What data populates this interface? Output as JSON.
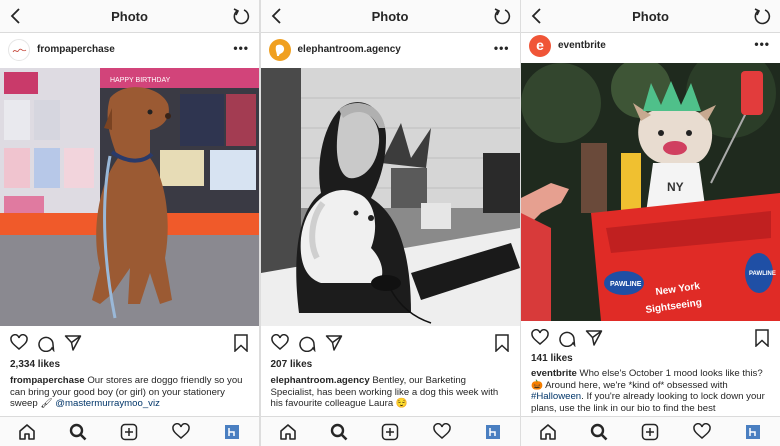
{
  "posts": [
    {
      "header_title": "Photo",
      "username": "frompaperchase",
      "avatar_text": "Paperchase",
      "more_label": "•••",
      "likes": "2,334 likes",
      "caption_user": "frompaperchase",
      "caption_text": "Our stores are doggo friendly so you can bring your good boy (or girl) on your stationery sweep 🖌",
      "caption_mention": "@mastermurraymoo_viz",
      "photo_sign": "HAPPY BIRTHDAY"
    },
    {
      "header_title": "Photo",
      "username": "elephantroom.agency",
      "more_label": "•••",
      "likes": "207 likes",
      "caption_user": "elephantroom.agency",
      "caption_text": "Bentley, our Barketing Specialist, has been working like a dog this week with his favourite colleague Laura 😌"
    },
    {
      "header_title": "Photo",
      "username": "eventbrite",
      "avatar_letter": "e",
      "more_label": "•••",
      "likes": "141 likes",
      "caption_user": "eventbrite",
      "caption_text_1": "Who else's October 1 mood looks like this? 🎃 Around here, we're *kind of* obsessed with ",
      "caption_hashtag": "#Halloween",
      "caption_text_2": ". If you're already looking to lock down your plans, use the link in our bio to find the best",
      "photo_text_1": "PAWLINE",
      "photo_text_2": "New York",
      "photo_text_3": "Sightseeing",
      "photo_text_4": "NY",
      "photo_text_5": "PAWLINE"
    }
  ],
  "colors": {
    "link": "#003569",
    "eventbrite": "#f05537",
    "elephant": "#f0a020"
  }
}
